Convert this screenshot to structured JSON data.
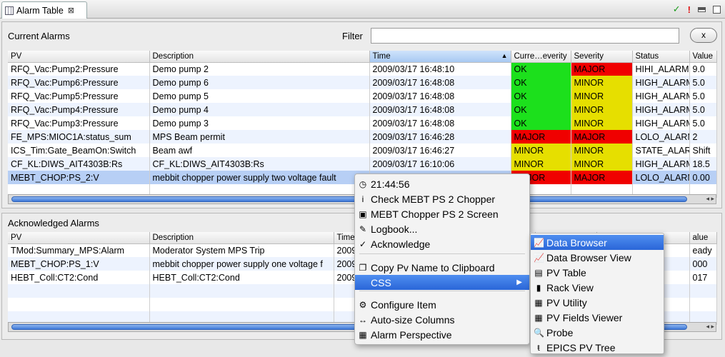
{
  "tab": {
    "title": "Alarm Table",
    "close": "⊠"
  },
  "toolbar": {
    "ack_icon": "✓",
    "alert_icon": "!"
  },
  "current": {
    "title": "Current Alarms",
    "filter_label": "Filter",
    "filter_value": "",
    "clear_label": "x",
    "columns": [
      "PV",
      "Description",
      "Time",
      "Curre…everity",
      "Severity",
      "Status",
      "Value"
    ],
    "rows": [
      [
        "RFQ_Vac:Pump2:Pressure",
        "Demo pump 2",
        "2009/03/17 16:48:10",
        "OK",
        "MAJOR",
        "HIHI_ALARM",
        "9.0"
      ],
      [
        "RFQ_Vac:Pump6:Pressure",
        "Demo pump 6",
        "2009/03/17 16:48:08",
        "OK",
        "MINOR",
        "HIGH_ALARM",
        "5.0"
      ],
      [
        "RFQ_Vac:Pump5:Pressure",
        "Demo pump 5",
        "2009/03/17 16:48:08",
        "OK",
        "MINOR",
        "HIGH_ALARM",
        "5.0"
      ],
      [
        "RFQ_Vac:Pump4:Pressure",
        "Demo pump 4",
        "2009/03/17 16:48:08",
        "OK",
        "MINOR",
        "HIGH_ALARM",
        "5.0"
      ],
      [
        "RFQ_Vac:Pump3:Pressure",
        "Demo pump 3",
        "2009/03/17 16:48:08",
        "OK",
        "MINOR",
        "HIGH_ALARM",
        "5.0"
      ],
      [
        "FE_MPS:MIOC1A:status_sum",
        "MPS Beam permit",
        "2009/03/17 16:46:28",
        "MAJOR",
        "MAJOR",
        "LOLO_ALARM",
        "2"
      ],
      [
        "ICS_Tim:Gate_BeamOn:Switch",
        "Beam awf",
        "2009/03/17 16:46:27",
        "MINOR",
        "MINOR",
        "STATE_ALARM",
        "Shift"
      ],
      [
        "CF_KL:DIWS_AIT4303B:Rs",
        "CF_KL:DIWS_AIT4303B:Rs",
        "2009/03/17 16:10:06",
        "MINOR",
        "MINOR",
        "HIGH_ALARM",
        "18.5"
      ],
      [
        "MEBT_CHOP:PS_2:V",
        "mebbit chopper power supply two voltage fault",
        "",
        "MAJOR",
        "MAJOR",
        "LOLO_ALARM",
        "0.00"
      ]
    ]
  },
  "acknowledged": {
    "title": "Acknowledged Alarms",
    "columns": [
      "PV",
      "Description",
      "Time",
      "",
      "",
      "",
      "alue"
    ],
    "rows": [
      [
        "TMod:Summary_MPS:Alarm",
        "Moderator System MPS Trip",
        "2009",
        "",
        "",
        "",
        "eady"
      ],
      [
        "MEBT_CHOP:PS_1:V",
        "mebbit chopper power supply one voltage f",
        "2009",
        "",
        "",
        "",
        "000"
      ],
      [
        "HEBT_Coll:CT2:Cond",
        "HEBT_Coll:CT2:Cond",
        "2009",
        "",
        "",
        "",
        "017"
      ]
    ]
  },
  "context_menu": {
    "items": [
      {
        "label": "21:44:56",
        "icon": "clock-icon",
        "glyph": "◷"
      },
      {
        "label": "Check MEBT PS 2 Chopper",
        "icon": "info-icon",
        "glyph": "i"
      },
      {
        "label": "MEBT Chopper PS 2 Screen",
        "icon": "screen-icon",
        "glyph": "▣"
      },
      {
        "label": "Logbook...",
        "icon": "pencil-icon",
        "glyph": "✎"
      },
      {
        "label": "Acknowledge",
        "icon": "check-icon",
        "glyph": "✓"
      },
      {
        "label": "Copy Pv Name to Clipboard",
        "icon": "copy-icon",
        "glyph": "❐"
      },
      {
        "label": "CSS",
        "icon": "",
        "glyph": ""
      },
      {
        "label": "Configure Item",
        "icon": "configure-icon",
        "glyph": "⚙"
      },
      {
        "label": "Auto-size Columns",
        "icon": "autosize-icon",
        "glyph": "↔"
      },
      {
        "label": "Alarm Perspective",
        "icon": "perspective-icon",
        "glyph": "▦"
      }
    ]
  },
  "submenu": {
    "items": [
      {
        "label": "Data Browser",
        "icon": "data-browser-icon",
        "glyph": "📈"
      },
      {
        "label": "Data Browser View",
        "icon": "data-browser-view-icon",
        "glyph": "📈"
      },
      {
        "label": "PV Table",
        "icon": "pv-table-icon",
        "glyph": "▤"
      },
      {
        "label": "Rack View",
        "icon": "rack-view-icon",
        "glyph": "▮"
      },
      {
        "label": "PV Utility",
        "icon": "pv-utility-icon",
        "glyph": "▦"
      },
      {
        "label": "PV Fields Viewer",
        "icon": "pv-fields-icon",
        "glyph": "▦"
      },
      {
        "label": "Probe",
        "icon": "probe-icon",
        "glyph": "🔍"
      },
      {
        "label": "EPICS PV Tree",
        "icon": "pv-tree-icon",
        "glyph": "ŧ"
      }
    ]
  },
  "colors": {
    "ok": "#1ce01c",
    "major": "#f00000",
    "minor": "#e6df00",
    "highlight": "#2a66d8"
  }
}
